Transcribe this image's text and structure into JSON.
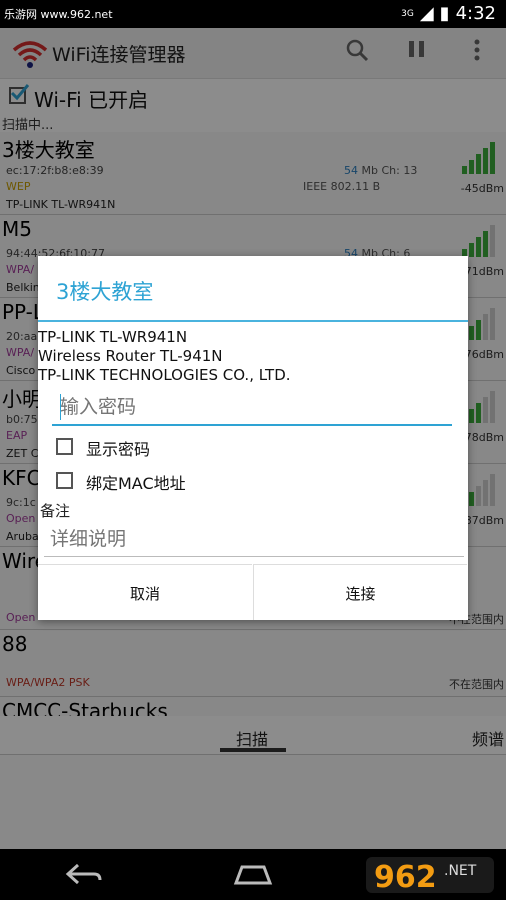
{
  "statusbar": {
    "watermark": "乐游网 www.962.net",
    "network": "3G",
    "time": "4:32"
  },
  "appbar": {
    "title": "WiFi连接管理器",
    "logo_icon": "wifi-logo-icon",
    "search_icon": "search-icon",
    "pause_icon": "pause-icon",
    "menu_icon": "overflow-menu-icon"
  },
  "wifi": {
    "label": "Wi-Fi 已开启",
    "checked": true
  },
  "scan_status": "扫描中...",
  "networks": [
    {
      "ssid": "3楼大教室",
      "mac": "ec:17:2f:b8:e8:39",
      "speed_num": "54",
      "speed_unit": "Mb",
      "channel": "Ch: 13",
      "security": "WEP",
      "standard": "IEEE 802.11 B",
      "vendor": "TP-LINK TL-WR941N",
      "dbm": "-45dBm"
    },
    {
      "ssid": "M5",
      "mac": "94:44:52:6f:10:77",
      "speed_num": "54",
      "speed_unit": "Mb",
      "channel": "Ch: 6",
      "security": "WPA/",
      "standard": "",
      "vendor": "Belkin",
      "dbm": "-71dBm"
    },
    {
      "ssid": "PP-L",
      "mac": "20:aa",
      "speed_num": "",
      "speed_unit": "",
      "channel": "",
      "security": "WPA/",
      "standard": "",
      "vendor": "Cisco",
      "dbm": "-76dBm"
    },
    {
      "ssid": "小明",
      "mac": "b0:75",
      "speed_num": "",
      "speed_unit": "",
      "channel": "",
      "security": "EAP",
      "standard": "",
      "vendor": "ZET C",
      "dbm": "-78dBm"
    },
    {
      "ssid": "KFC",
      "mac": "9c:1c",
      "speed_num": "",
      "speed_unit": "",
      "channel": "",
      "security": "Open",
      "standard": "",
      "vendor": "Aruba",
      "dbm": "-87dBm"
    },
    {
      "ssid": "Wire",
      "mac": "",
      "speed_num": "",
      "speed_unit": "",
      "channel": "",
      "security": "Open",
      "standard": "",
      "vendor": "",
      "dbm": "不在范围内"
    },
    {
      "ssid": "88",
      "mac": "",
      "speed_num": "",
      "speed_unit": "",
      "channel": "",
      "security": "WPA/WPA2 PSK",
      "standard": "",
      "vendor": "",
      "dbm": "不在范围内"
    },
    {
      "ssid": "CMCC-Starbucks",
      "mac": "",
      "speed_num": "",
      "speed_unit": "",
      "channel": "",
      "security": "",
      "standard": "",
      "vendor": "",
      "dbm": ""
    }
  ],
  "tabs": {
    "scan": "扫描",
    "spectrum": "频谱"
  },
  "dialog": {
    "title": "3楼大教室",
    "info_line1": "TP-LINK TL-WR941N",
    "info_line2": "Wireless Router TL-941N",
    "info_line3": "TP-LINK TECHNOLOGIES CO., LTD.",
    "password_placeholder": "输入密码",
    "show_password": "显示密码",
    "bind_mac": "绑定MAC地址",
    "note_label": "备注",
    "note_placeholder": "详细说明",
    "cancel": "取消",
    "connect": "连接"
  },
  "colors": {
    "accent": "#2ea3d4",
    "signal": "#3cae3c",
    "security_wep": "#c8a000",
    "security_other": "#a23c9c"
  }
}
